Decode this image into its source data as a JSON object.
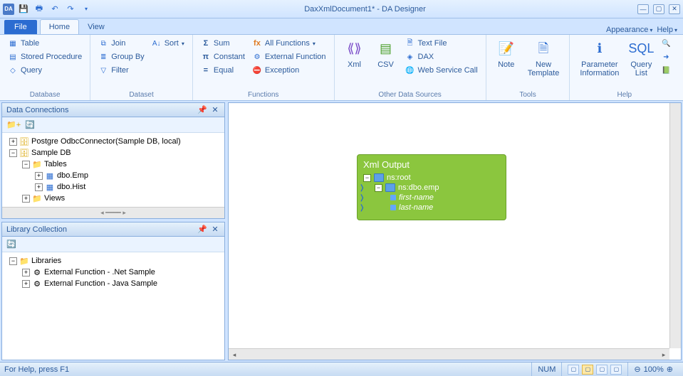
{
  "app": {
    "title": "DaxXmlDocument1* - DA Designer"
  },
  "tabs": {
    "file": "File",
    "home": "Home",
    "view": "View",
    "appearance": "Appearance",
    "help": "Help"
  },
  "ribbon": {
    "database": {
      "label": "Database",
      "table": "Table",
      "sproc": "Stored Procedure",
      "query": "Query"
    },
    "dataset": {
      "label": "Dataset",
      "join": "Join",
      "groupby": "Group By",
      "filter": "Filter",
      "sort": "Sort"
    },
    "functions": {
      "label": "Functions",
      "sum": "Sum",
      "constant": "Constant",
      "equal": "Equal",
      "allfunc": "All Functions",
      "extfunc": "External Function",
      "exception": "Exception"
    },
    "other": {
      "label": "Other Data Sources",
      "xml": "Xml",
      "csv": "CSV",
      "text": "Text File",
      "dax": "DAX",
      "ws": "Web Service Call"
    },
    "tools": {
      "label": "Tools",
      "note": "Note",
      "newtpl": "New\nTemplate"
    },
    "helpg": {
      "label": "Help",
      "param": "Parameter\nInformation",
      "qlist": "Query\nList"
    }
  },
  "panels": {
    "dc": {
      "title": "Data Connections",
      "tree": {
        "postgre": "Postgre OdbcConnector(Sample DB, local)",
        "sampledb": "Sample DB",
        "tables": "Tables",
        "emp": "dbo.Emp",
        "hist": "dbo.Hist",
        "views": "Views"
      }
    },
    "lc": {
      "title": "Library Collection",
      "root": "Libraries",
      "net": "External Function - .Net Sample",
      "java": "External Function - Java Sample"
    }
  },
  "canvas": {
    "xmlout": {
      "title": "Xml Output",
      "root": "ns:root",
      "emp": "ns:dbo.emp",
      "first": "first-name",
      "last": "last-name"
    }
  },
  "status": {
    "help": "For Help, press F1",
    "num": "NUM",
    "zoom": "100%"
  }
}
